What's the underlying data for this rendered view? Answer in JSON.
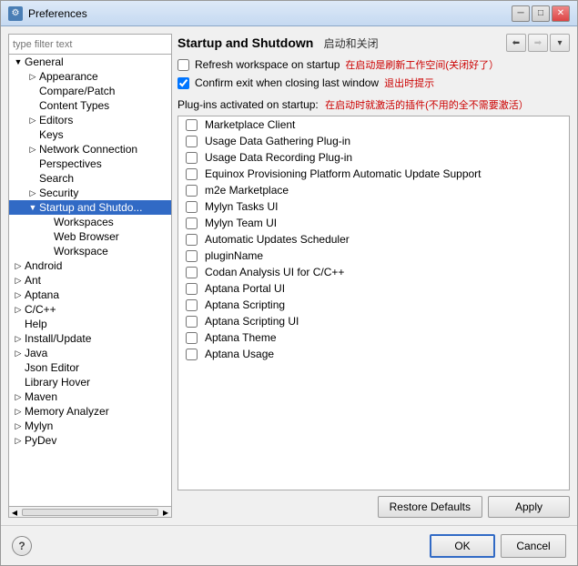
{
  "window": {
    "title": "Preferences",
    "icon": "⚙"
  },
  "titlebar": {
    "minimize": "─",
    "maximize": "□",
    "close": "✕"
  },
  "filter": {
    "placeholder": "type filter text"
  },
  "tree": {
    "items": [
      {
        "id": "general",
        "label": "General",
        "indent": 1,
        "expand": "▼",
        "bold": false
      },
      {
        "id": "appearance",
        "label": "Appearance",
        "indent": 2,
        "expand": "▷",
        "bold": false
      },
      {
        "id": "compare-patch",
        "label": "Compare/Patch",
        "indent": 2,
        "expand": "",
        "bold": false
      },
      {
        "id": "content-types",
        "label": "Content Types",
        "indent": 2,
        "expand": "",
        "bold": false
      },
      {
        "id": "editors",
        "label": "Editors",
        "indent": 2,
        "expand": "▷",
        "bold": false
      },
      {
        "id": "keys",
        "label": "Keys",
        "indent": 2,
        "expand": "",
        "bold": false
      },
      {
        "id": "network-connection",
        "label": "Network Connection",
        "indent": 2,
        "expand": "▷",
        "bold": false
      },
      {
        "id": "perspectives",
        "label": "Perspectives",
        "indent": 2,
        "expand": "",
        "bold": false
      },
      {
        "id": "search",
        "label": "Search",
        "indent": 2,
        "expand": "",
        "bold": false
      },
      {
        "id": "security",
        "label": "Security",
        "indent": 2,
        "expand": "▷",
        "bold": false
      },
      {
        "id": "startup-shutdown",
        "label": "Startup and Shutdo...",
        "indent": 2,
        "expand": "▼",
        "bold": false,
        "selected": true
      },
      {
        "id": "workspaces",
        "label": "Workspaces",
        "indent": 3,
        "expand": "",
        "bold": false
      },
      {
        "id": "web-browser",
        "label": "Web Browser",
        "indent": 3,
        "expand": "",
        "bold": false
      },
      {
        "id": "workspace",
        "label": "Workspace",
        "indent": 3,
        "expand": "",
        "bold": false
      },
      {
        "id": "android",
        "label": "Android",
        "indent": 1,
        "expand": "▷",
        "bold": false
      },
      {
        "id": "ant",
        "label": "Ant",
        "indent": 1,
        "expand": "▷",
        "bold": false
      },
      {
        "id": "aptana",
        "label": "Aptana",
        "indent": 1,
        "expand": "▷",
        "bold": false
      },
      {
        "id": "cpp",
        "label": "C/C++",
        "indent": 1,
        "expand": "▷",
        "bold": false
      },
      {
        "id": "help",
        "label": "Help",
        "indent": 1,
        "expand": "",
        "bold": false
      },
      {
        "id": "install-update",
        "label": "Install/Update",
        "indent": 1,
        "expand": "▷",
        "bold": false
      },
      {
        "id": "java",
        "label": "Java",
        "indent": 1,
        "expand": "▷",
        "bold": false
      },
      {
        "id": "json-editor",
        "label": "Json Editor",
        "indent": 1,
        "expand": "",
        "bold": false
      },
      {
        "id": "library-hover",
        "label": "Library Hover",
        "indent": 1,
        "expand": "",
        "bold": false
      },
      {
        "id": "maven",
        "label": "Maven",
        "indent": 1,
        "expand": "▷",
        "bold": false
      },
      {
        "id": "memory-analyzer",
        "label": "Memory Analyzer",
        "indent": 1,
        "expand": "▷",
        "bold": false
      },
      {
        "id": "mylyn",
        "label": "Mylyn",
        "indent": 1,
        "expand": "▷",
        "bold": false
      },
      {
        "id": "pydev",
        "label": "PyDev",
        "indent": 1,
        "expand": "▷",
        "bold": false
      }
    ]
  },
  "right": {
    "title": "Startup and Shutdown",
    "title_cn": "启动和关闭",
    "checkbox1": {
      "label": "Refresh workspace on startup",
      "label_cn": "在启动是刷新工作空间(关闭好了）",
      "checked": false
    },
    "checkbox2": {
      "label": "Confirm exit when closing last window",
      "label_cn": "退出时提示",
      "checked": true
    },
    "plugins_label": "Plug-ins activated on startup:",
    "plugins_label_cn": "在启动时就激活的插件(不用的全不需要激活）",
    "plugins": [
      {
        "label": "Marketplace Client",
        "checked": false
      },
      {
        "label": "Usage Data Gathering Plug-in",
        "checked": false
      },
      {
        "label": "Usage Data Recording Plug-in",
        "checked": false
      },
      {
        "label": "Equinox Provisioning Platform Automatic Update Support",
        "checked": false
      },
      {
        "label": "m2e Marketplace",
        "checked": false
      },
      {
        "label": "Mylyn Tasks UI",
        "checked": false
      },
      {
        "label": "Mylyn Team UI",
        "checked": false
      },
      {
        "label": "Automatic Updates Scheduler",
        "checked": false
      },
      {
        "label": "pluginName",
        "checked": false
      },
      {
        "label": "Codan Analysis UI for C/C++",
        "checked": false
      },
      {
        "label": "Aptana Portal UI",
        "checked": false
      },
      {
        "label": "Aptana Scripting",
        "checked": false
      },
      {
        "label": "Aptana Scripting UI",
        "checked": false
      },
      {
        "label": "Aptana Theme",
        "checked": false
      },
      {
        "label": "Aptana Usage",
        "checked": false
      }
    ],
    "restore_defaults_btn": "Restore Defaults",
    "apply_btn": "Apply"
  },
  "bottom": {
    "help_symbol": "?",
    "ok_btn": "OK",
    "cancel_btn": "Cancel"
  }
}
